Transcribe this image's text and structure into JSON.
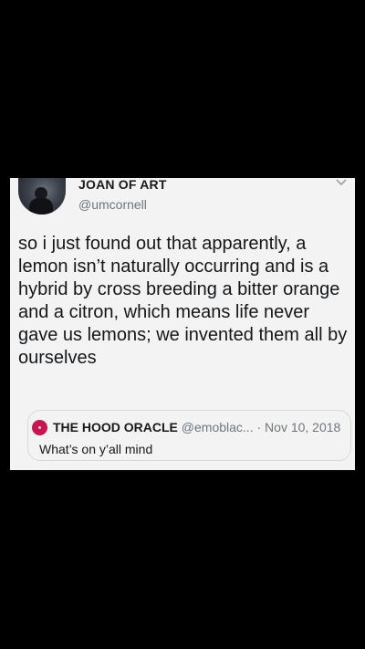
{
  "tweet": {
    "display_name": "JOAN OF ART",
    "handle": "@umcornell",
    "text": "so i just found out that apparently, a lemon isn’t naturally occurring and is a hybrid by cross breeding a bitter orange and a citron, which means life never gave us lemons; we invented them all by ourselves",
    "avatar_icon": "user-photo-avatar",
    "menu_icon": "chevron-down-icon"
  },
  "quoted_tweet": {
    "display_name": "THE HOOD ORACLE",
    "handle": "@emoblac...",
    "separator": "·",
    "date": "Nov 10, 2018",
    "text": "What’s on y’all mind",
    "avatar_color": "#c4164f"
  },
  "colors": {
    "background": "#000000",
    "card": "#f3f3f3",
    "secondary_text": "#6e767d",
    "primary_text": "#14171a"
  }
}
